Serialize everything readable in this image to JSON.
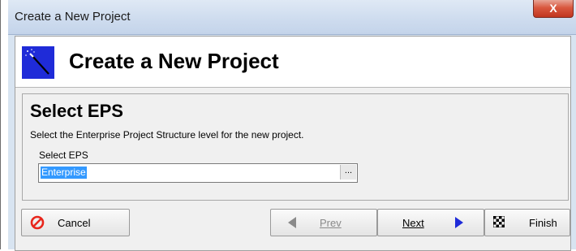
{
  "window": {
    "title": "Create a New Project",
    "close_label": "X"
  },
  "header": {
    "title": "Create a New Project"
  },
  "step": {
    "title": "Select EPS",
    "description": "Select the Enterprise Project Structure level for the new project.",
    "field_label": "Select EPS",
    "field_value": "Enterprise",
    "browse_label": "..."
  },
  "buttons": {
    "cancel": "Cancel",
    "prev": "Prev",
    "next": "Next",
    "finish": "Finish"
  },
  "colors": {
    "wand_bg": "#1f2bd8",
    "cancel_icon": "#e8261c",
    "arrow": "#1f2bd8",
    "selection": "#3399ff"
  }
}
